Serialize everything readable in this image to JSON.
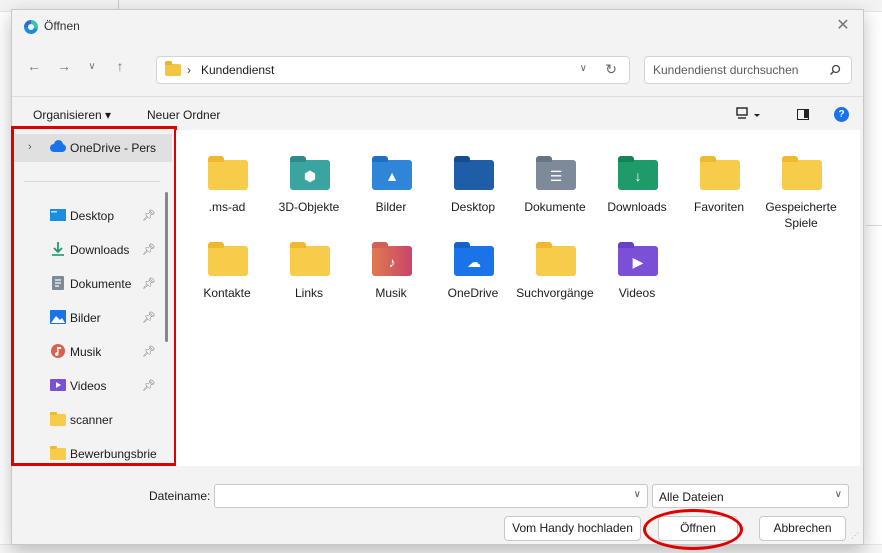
{
  "window": {
    "title": "Öffnen"
  },
  "address": {
    "path": "Kundendienst",
    "separator": "›"
  },
  "search": {
    "placeholder": "Kundendienst durchsuchen"
  },
  "toolbar": {
    "organize_label": "Organisieren ▾",
    "new_folder_label": "Neuer Ordner"
  },
  "navpane": {
    "onedrive_label": "OneDrive - Pers",
    "items": [
      {
        "label": "Desktop",
        "icon": "desktop-icon",
        "pinned": true
      },
      {
        "label": "Downloads",
        "icon": "download-icon",
        "pinned": true
      },
      {
        "label": "Dokumente",
        "icon": "document-icon",
        "pinned": true
      },
      {
        "label": "Bilder",
        "icon": "picture-icon",
        "pinned": true
      },
      {
        "label": "Musik",
        "icon": "music-icon",
        "pinned": true
      },
      {
        "label": "Videos",
        "icon": "video-icon",
        "pinned": true
      },
      {
        "label": "scanner",
        "icon": "folder-icon",
        "pinned": false
      },
      {
        "label": "Bewerbungsbrie",
        "icon": "folder-icon",
        "pinned": false
      }
    ]
  },
  "files": [
    {
      "label": ".ms-ad",
      "icon": "folder-icon"
    },
    {
      "label": "3D-Objekte",
      "icon": "3d-objects-icon"
    },
    {
      "label": "Bilder",
      "icon": "pictures-folder-icon"
    },
    {
      "label": "Desktop",
      "icon": "desktop-folder-icon"
    },
    {
      "label": "Dokumente",
      "icon": "documents-folder-icon"
    },
    {
      "label": "Downloads",
      "icon": "downloads-folder-icon"
    },
    {
      "label": "Favoriten",
      "icon": "folder-icon"
    },
    {
      "label": "Gespeicherte Spiele",
      "icon": "folder-icon"
    },
    {
      "label": "Kontakte",
      "icon": "folder-icon"
    },
    {
      "label": "Links",
      "icon": "folder-icon"
    },
    {
      "label": "Musik",
      "icon": "music-folder-icon"
    },
    {
      "label": "OneDrive",
      "icon": "onedrive-folder-icon"
    },
    {
      "label": "Suchvorgänge",
      "icon": "folder-icon"
    },
    {
      "label": "Videos",
      "icon": "videos-folder-icon"
    }
  ],
  "bottom": {
    "filename_label": "Dateiname:",
    "filename_value": "",
    "filetype_value": "Alle Dateien",
    "upload_button": "Vom Handy hochladen",
    "open_button": "Öffnen",
    "cancel_button": "Abbrechen"
  },
  "colors": {
    "annotation": "#e00000",
    "accent": "#1a73e8"
  }
}
